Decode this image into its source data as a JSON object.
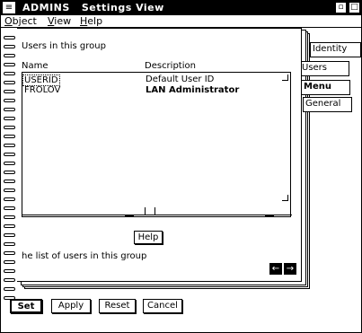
{
  "titlebar": {
    "app": "ADMINS",
    "view": "Settings View",
    "system_glyph": "≡",
    "minimize_glyph": "▫",
    "maximize_glyph": "□"
  },
  "menubar": {
    "items": [
      {
        "label": "Object"
      },
      {
        "label": "View"
      },
      {
        "label": "Help"
      }
    ]
  },
  "notebook": {
    "tabs": [
      {
        "label": "Identity"
      },
      {
        "label": "Users"
      },
      {
        "label": "Menu"
      },
      {
        "label": "General"
      }
    ],
    "page": {
      "heading": "Users in this group",
      "columns": [
        "Name",
        "Description"
      ],
      "rows": [
        {
          "name": "USERID",
          "description": "Default User ID"
        },
        {
          "name": "FROLOV",
          "description": "LAN Administrator"
        }
      ],
      "help_label": "Help",
      "info_text": "he list of users in this group",
      "prev_page_glyph": "←",
      "next_page_glyph": "→"
    }
  },
  "buttons": {
    "set": "Set",
    "apply": "Apply",
    "reset": "Reset",
    "cancel": "Cancel"
  }
}
